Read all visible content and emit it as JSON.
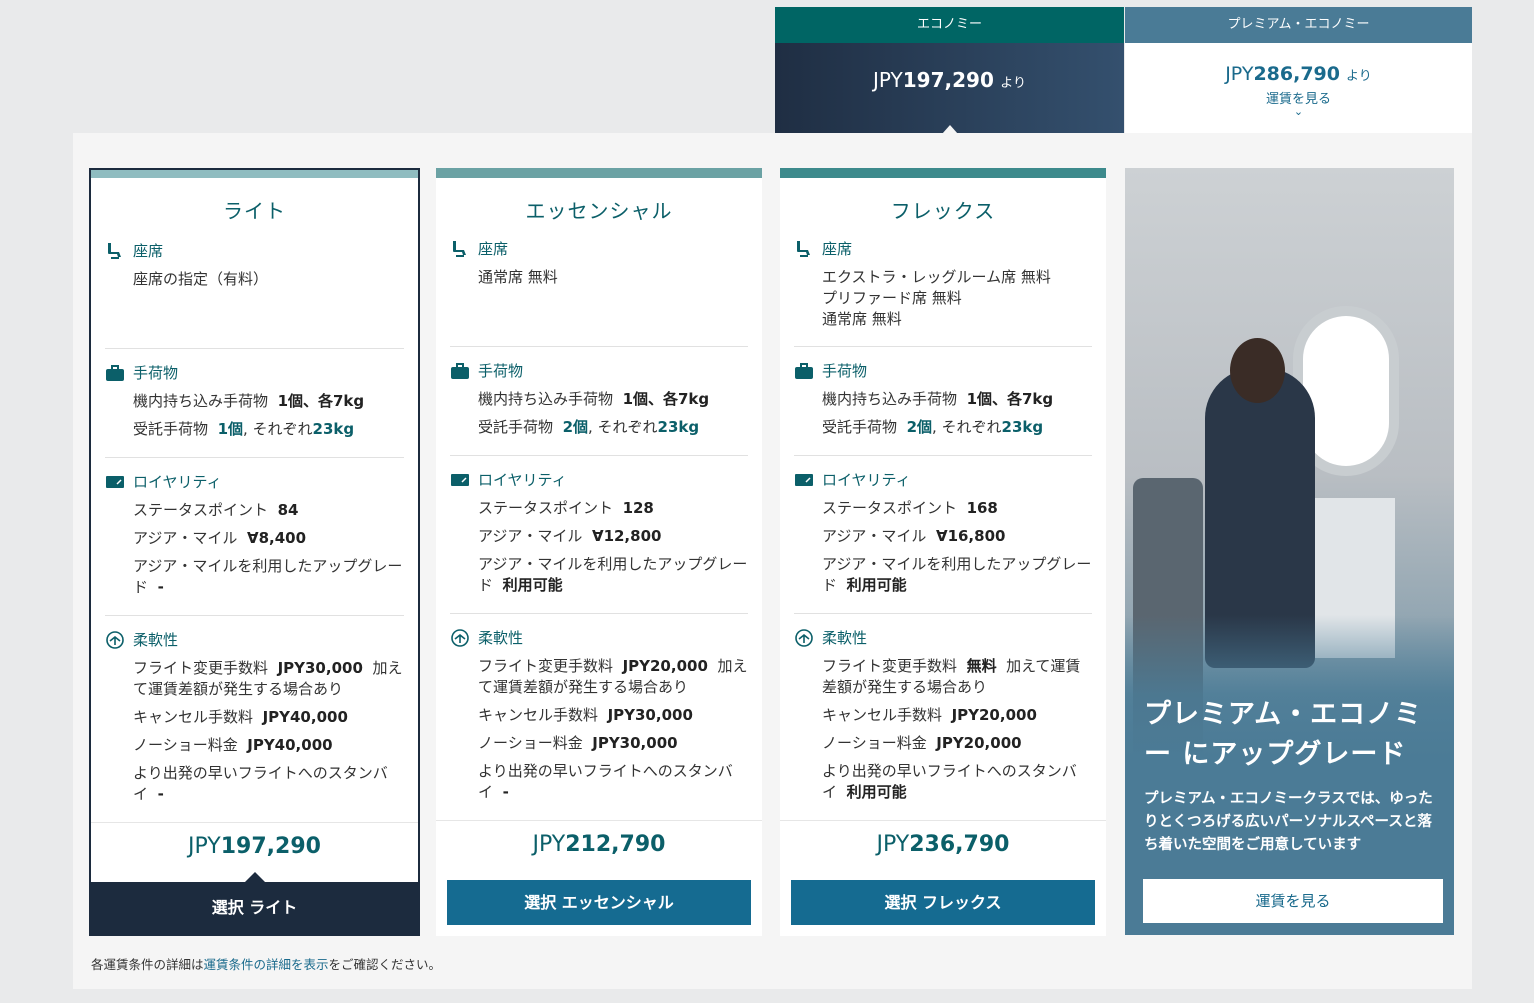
{
  "tabs": {
    "economy": {
      "label": "エコノミー",
      "currency": "JPY",
      "amount": "197,290",
      "suffix": "より"
    },
    "premium": {
      "label": "プレミアム・エコノミー",
      "currency": "JPY",
      "amount": "286,790",
      "suffix": "より",
      "link": "運賃を見る"
    }
  },
  "sections": {
    "seat": "座席",
    "baggage": "手荷物",
    "loyalty": "ロイヤリティ",
    "flex": "柔軟性"
  },
  "cards": [
    {
      "title": "ライト",
      "seat_lines": [
        "座席の指定（有料）"
      ],
      "carry_on_label": "機内持ち込み手荷物",
      "carry_on_value": "1個、各7kg",
      "checked_label": "受託手荷物",
      "checked_count": "1個",
      "checked_sep": ", それぞれ",
      "checked_weight": "23kg",
      "status_label": "ステータスポイント",
      "status_value": "84",
      "miles_label": "アジア・マイル",
      "miles_value": "8,400",
      "upgrade_label": "アジア・マイルを利用したアップグレード",
      "upgrade_value": "-",
      "change_label": "フライト変更手数料",
      "change_value": "JPY30,000",
      "change_note": "加えて運賃差額が発生する場合あり",
      "cancel_label": "キャンセル手数料",
      "cancel_value": "JPY40,000",
      "noshow_label": "ノーショー料金",
      "noshow_value": "JPY40,000",
      "standby_label": "より出発の早いフライトへのスタンバイ",
      "standby_value": "-",
      "currency": "JPY",
      "price": "197,290",
      "select": "選択 ライト"
    },
    {
      "title": "エッセンシャル",
      "seat_lines": [
        "通常席 無料"
      ],
      "carry_on_label": "機内持ち込み手荷物",
      "carry_on_value": "1個、各7kg",
      "checked_label": "受託手荷物",
      "checked_count": "2個",
      "checked_sep": ", それぞれ",
      "checked_weight": "23kg",
      "status_label": "ステータスポイント",
      "status_value": "128",
      "miles_label": "アジア・マイル",
      "miles_value": "12,800",
      "upgrade_label": "アジア・マイルを利用したアップグレード",
      "upgrade_value": "利用可能",
      "change_label": "フライト変更手数料",
      "change_value": "JPY20,000",
      "change_note": "加えて運賃差額が発生する場合あり",
      "cancel_label": "キャンセル手数料",
      "cancel_value": "JPY30,000",
      "noshow_label": "ノーショー料金",
      "noshow_value": "JPY30,000",
      "standby_label": "より出発の早いフライトへのスタンバイ",
      "standby_value": "-",
      "currency": "JPY",
      "price": "212,790",
      "select": "選択 エッセンシャル"
    },
    {
      "title": "フレックス",
      "seat_lines": [
        "エクストラ・レッグルーム席 無料",
        "プリファード席 無料",
        "通常席 無料"
      ],
      "carry_on_label": "機内持ち込み手荷物",
      "carry_on_value": "1個、各7kg",
      "checked_label": "受託手荷物",
      "checked_count": "2個",
      "checked_sep": ", それぞれ",
      "checked_weight": "23kg",
      "status_label": "ステータスポイント",
      "status_value": "168",
      "miles_label": "アジア・マイル",
      "miles_value": "16,800",
      "upgrade_label": "アジア・マイルを利用したアップグレード",
      "upgrade_value": "利用可能",
      "change_label": "フライト変更手数料",
      "change_value": "無料",
      "change_note": "加えて運賃差額が発生する場合あり",
      "cancel_label": "キャンセル手数料",
      "cancel_value": "JPY20,000",
      "noshow_label": "ノーショー料金",
      "noshow_value": "JPY20,000",
      "standby_label": "より出発の早いフライトへのスタンバイ",
      "standby_value": "利用可能",
      "currency": "JPY",
      "price": "236,790",
      "select": "選択 フレックス"
    }
  ],
  "upgrade": {
    "title": "プレミアム・エコノミー にアップグレード",
    "text": "プレミアム・エコノミークラスでは、ゆったりとくつろげる広いパーソナルスペースと落ち着いた空間をご用意しています",
    "button": "運賃を見る"
  },
  "footnote": {
    "pre": "各運賃条件の詳細は",
    "link": "運賃条件の詳細を表示",
    "post": "をご確認ください。"
  },
  "colors": {
    "teal": "#0b5f69",
    "navy": "#1c2b3e",
    "button_blue": "#156b91"
  }
}
